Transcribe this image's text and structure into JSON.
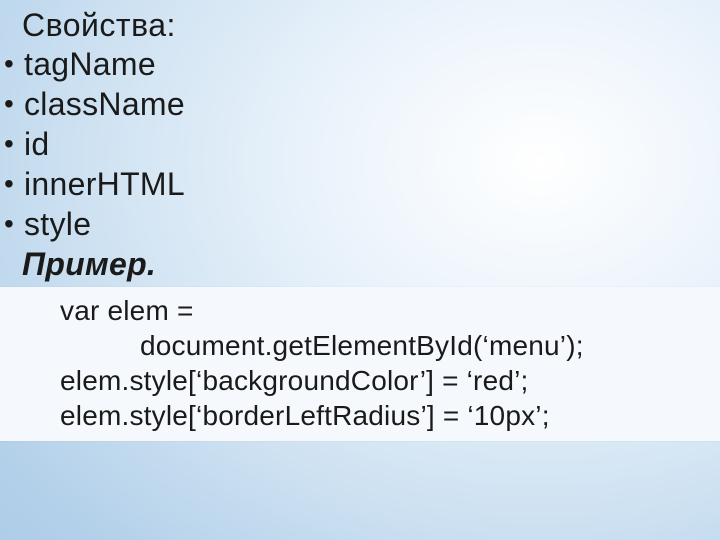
{
  "heading": "Свойства:",
  "bullets": [
    "tagName",
    "className",
    "id",
    "innerHTML",
    "style"
  ],
  "example_label": "Пример.",
  "code": {
    "l1": "var elem =",
    "l2": "document.getElementById(‘menu’);",
    "l3": "elem.style[‘backgroundColor’] = ‘red’;",
    "l4": "elem.style[‘borderLeftRadius’] = ‘10px’;"
  }
}
